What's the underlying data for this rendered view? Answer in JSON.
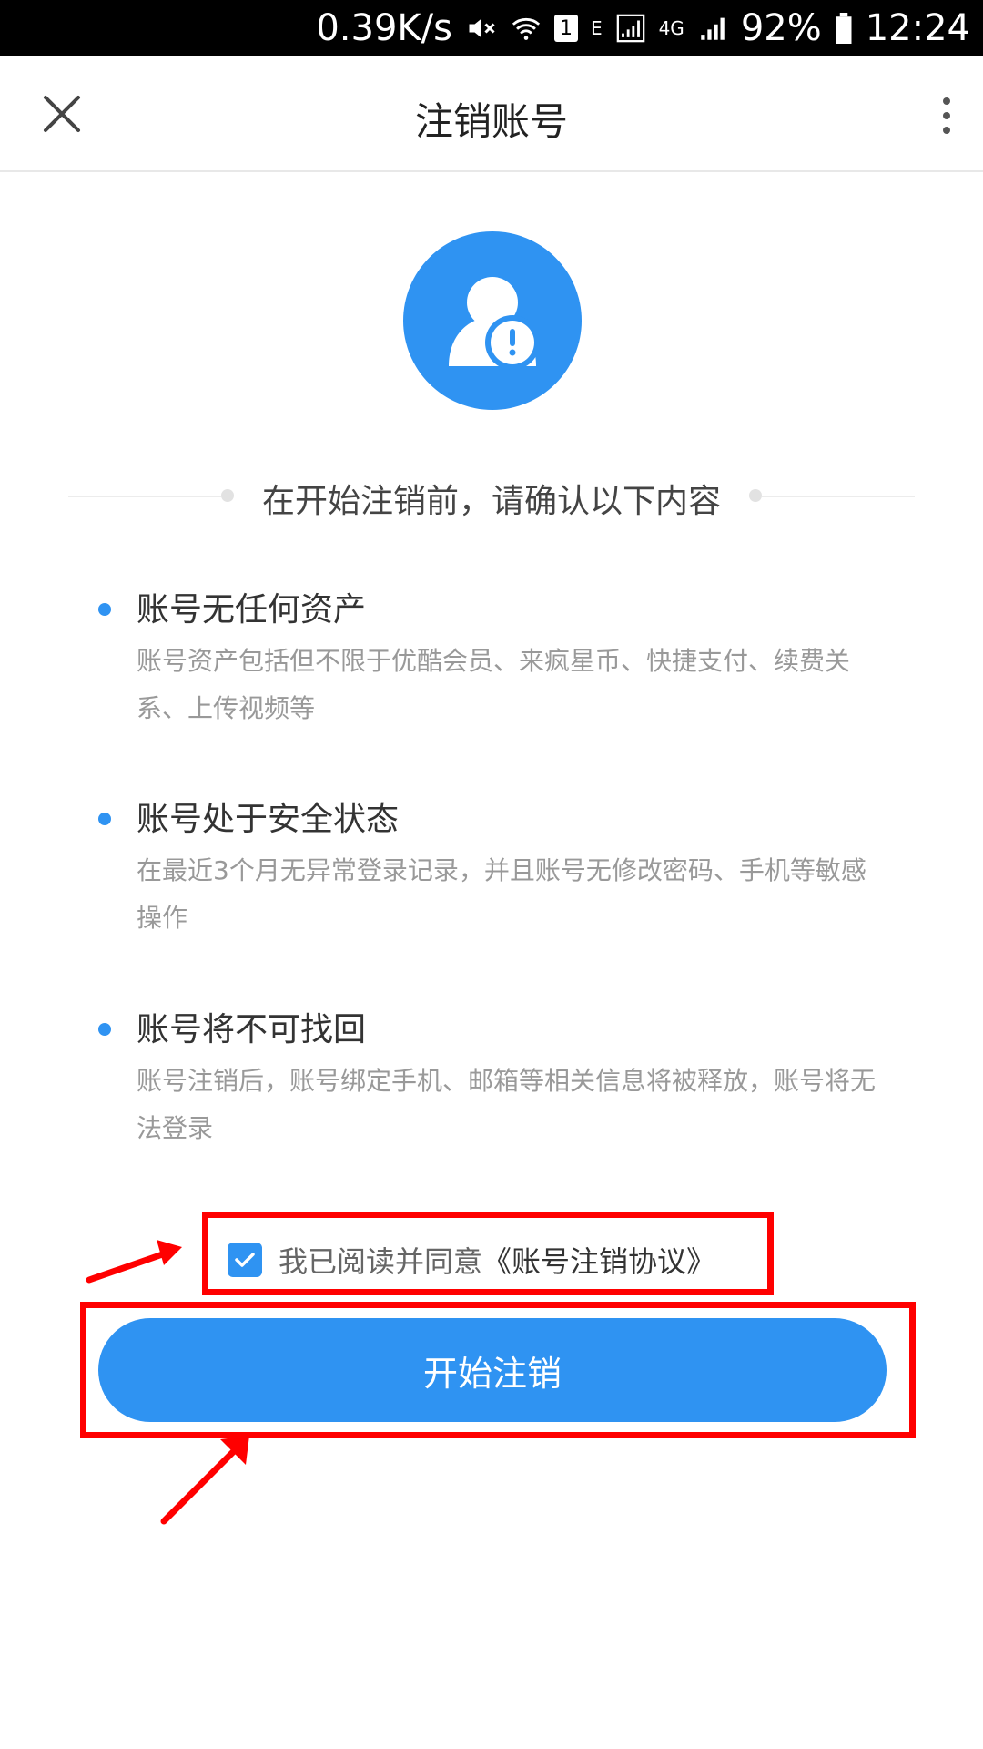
{
  "status_bar": {
    "speed": "0.39K/s",
    "sim_slot": "1",
    "network_e": "E",
    "network_4g": "4G",
    "battery": "92%",
    "time": "12:24"
  },
  "header": {
    "title": "注销账号"
  },
  "section_heading": "在开始注销前，请确认以下内容",
  "items": [
    {
      "title": "账号无任何资产",
      "desc": "账号资产包括但不限于优酷会员、来疯星币、快捷支付、续费关系、上传视频等"
    },
    {
      "title": "账号处于安全状态",
      "desc": "在最近3个月无异常登录记录，并且账号无修改密码、手机等敏感操作"
    },
    {
      "title": "账号将不可找回",
      "desc": "账号注销后，账号绑定手机、邮箱等相关信息将被释放，账号将无法登录"
    }
  ],
  "agreement": {
    "checked": true,
    "prefix": "我已阅读并同意",
    "link": "《账号注销协议》"
  },
  "start_button": "开始注销",
  "colors": {
    "accent": "#2f93f2",
    "annotation": "#ff0000"
  },
  "icons": {
    "close": "close-icon",
    "more": "more-vertical-icon",
    "avatar": "user-warning-icon",
    "check": "check-icon"
  }
}
